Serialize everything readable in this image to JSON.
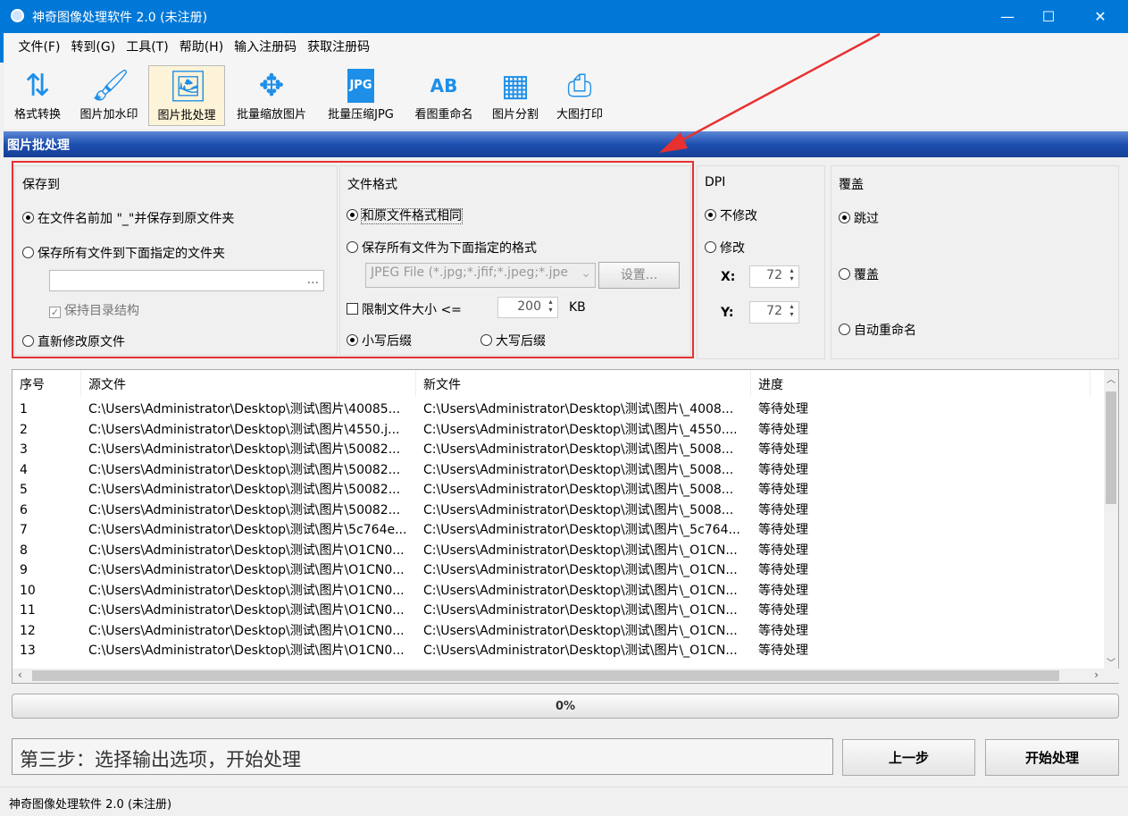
{
  "app": {
    "title": "神奇图像处理软件 2.0 (未注册)",
    "accent": "#0078d7"
  },
  "window_controls": {
    "minimize": "—",
    "maximize": "☐",
    "close": "✕"
  },
  "menu": [
    "文件(F)",
    "转到(G)",
    "工具(T)",
    "帮助(H)",
    "输入注册码",
    "获取注册码"
  ],
  "toolbar": [
    {
      "label": "格式转换",
      "icon": "convert-icon",
      "glyph": "⇅"
    },
    {
      "label": "图片加水印",
      "icon": "brush-icon",
      "glyph": "🖌"
    },
    {
      "label": "图片批处理",
      "icon": "image-icon",
      "glyph": "🖼"
    },
    {
      "label": "批量缩放图片",
      "icon": "move-arrows-icon",
      "glyph": "✥"
    },
    {
      "label": "批量压缩JPG",
      "icon": "jpg-file-icon",
      "glyph": "JPG"
    },
    {
      "label": "看图重命名",
      "icon": "rename-ab-icon",
      "glyph": "AB"
    },
    {
      "label": "图片分割",
      "icon": "grid-icon",
      "glyph": "▦"
    },
    {
      "label": "大图打印",
      "icon": "printer-icon",
      "glyph": "⎙"
    }
  ],
  "section_title": "图片批处理",
  "save_to": {
    "title": "保存到",
    "opt1": "在文件名前加 \"_\"并保存到原文件夹",
    "opt2": "保存所有文件到下面指定的文件夹",
    "folder_value": "",
    "browse": "...",
    "keep_structure": "保持目录结构",
    "opt3": "直新修改原文件"
  },
  "file_format": {
    "title": "文件格式",
    "opt1": "和原文件格式相同",
    "opt2": "保存所有文件为下面指定的格式",
    "format_value": "JPEG File (*.jpg;*.jfif;*.jpeg;*.jpe",
    "settings": "设置...",
    "limit_label": "限制文件大小 <=",
    "limit_value": "200",
    "limit_unit": "KB",
    "lower": "小写后缀",
    "upper": "大写后缀"
  },
  "dpi": {
    "title": "DPI",
    "no_change": "不修改",
    "change": "修改",
    "x_label": "X:",
    "x_value": "72",
    "y_label": "Y:",
    "y_value": "72"
  },
  "overwrite": {
    "title": "覆盖",
    "skip": "跳过",
    "overwrite": "覆盖",
    "auto_rename": "自动重命名"
  },
  "table": {
    "headers": [
      "序号",
      "源文件",
      "新文件",
      "进度"
    ],
    "rows": [
      [
        "1",
        "C:\\Users\\Administrator\\Desktop\\测试\\图片\\40085...",
        "C:\\Users\\Administrator\\Desktop\\测试\\图片\\_4008...",
        "等待处理"
      ],
      [
        "2",
        "C:\\Users\\Administrator\\Desktop\\测试\\图片\\4550.j...",
        "C:\\Users\\Administrator\\Desktop\\测试\\图片\\_4550....",
        "等待处理"
      ],
      [
        "3",
        "C:\\Users\\Administrator\\Desktop\\测试\\图片\\50082...",
        "C:\\Users\\Administrator\\Desktop\\测试\\图片\\_5008...",
        "等待处理"
      ],
      [
        "4",
        "C:\\Users\\Administrator\\Desktop\\测试\\图片\\50082...",
        "C:\\Users\\Administrator\\Desktop\\测试\\图片\\_5008...",
        "等待处理"
      ],
      [
        "5",
        "C:\\Users\\Administrator\\Desktop\\测试\\图片\\50082...",
        "C:\\Users\\Administrator\\Desktop\\测试\\图片\\_5008...",
        "等待处理"
      ],
      [
        "6",
        "C:\\Users\\Administrator\\Desktop\\测试\\图片\\50082...",
        "C:\\Users\\Administrator\\Desktop\\测试\\图片\\_5008...",
        "等待处理"
      ],
      [
        "7",
        "C:\\Users\\Administrator\\Desktop\\测试\\图片\\5c764e...",
        "C:\\Users\\Administrator\\Desktop\\测试\\图片\\_5c764...",
        "等待处理"
      ],
      [
        "8",
        "C:\\Users\\Administrator\\Desktop\\测试\\图片\\O1CN0...",
        "C:\\Users\\Administrator\\Desktop\\测试\\图片\\_O1CN...",
        "等待处理"
      ],
      [
        "9",
        "C:\\Users\\Administrator\\Desktop\\测试\\图片\\O1CN0...",
        "C:\\Users\\Administrator\\Desktop\\测试\\图片\\_O1CN...",
        "等待处理"
      ],
      [
        "10",
        "C:\\Users\\Administrator\\Desktop\\测试\\图片\\O1CN0...",
        "C:\\Users\\Administrator\\Desktop\\测试\\图片\\_O1CN...",
        "等待处理"
      ],
      [
        "11",
        "C:\\Users\\Administrator\\Desktop\\测试\\图片\\O1CN0...",
        "C:\\Users\\Administrator\\Desktop\\测试\\图片\\_O1CN...",
        "等待处理"
      ],
      [
        "12",
        "C:\\Users\\Administrator\\Desktop\\测试\\图片\\O1CN0...",
        "C:\\Users\\Administrator\\Desktop\\测试\\图片\\_O1CN...",
        "等待处理"
      ],
      [
        "13",
        "C:\\Users\\Administrator\\Desktop\\测试\\图片\\O1CN0...",
        "C:\\Users\\Administrator\\Desktop\\测试\\图片\\_O1CN...",
        "等待处理"
      ]
    ]
  },
  "progress": {
    "value": 0,
    "label": "0%"
  },
  "step_text": "第三步：选择输出选项，开始处理",
  "buttons": {
    "prev": "上一步",
    "start": "开始处理"
  },
  "status": "神奇图像处理软件 2.0 (未注册)"
}
